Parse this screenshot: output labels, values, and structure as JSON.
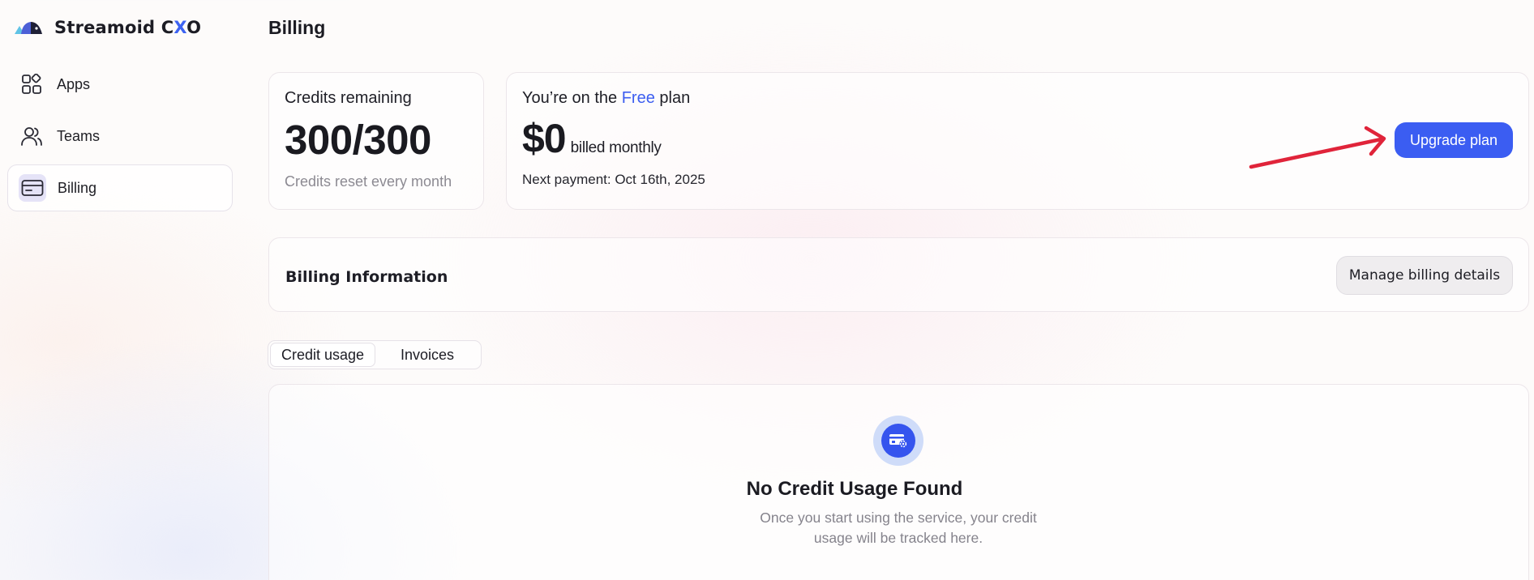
{
  "brand": {
    "name_prefix": "Streamoid C",
    "name_x": "X",
    "name_suffix": "O",
    "logo_icon": "streamoid-logo-icon"
  },
  "sidebar": {
    "items": [
      {
        "label": "Apps",
        "icon": "apps-grid-icon",
        "active": false
      },
      {
        "label": "Teams",
        "icon": "users-icon",
        "active": false
      },
      {
        "label": "Billing",
        "icon": "credit-card-icon",
        "active": true
      }
    ]
  },
  "page": {
    "title": "Billing"
  },
  "credits": {
    "label": "Credits remaining",
    "value": "300/300",
    "note": "Credits reset every month"
  },
  "plan": {
    "prefix": "You’re on the",
    "plan_name": "Free",
    "suffix": "plan",
    "price": "$0",
    "billing_period": "billed monthly",
    "next_payment": "Next payment: Oct 16th, 2025",
    "upgrade_label": "Upgrade plan"
  },
  "billing_info": {
    "title": "Billing Information",
    "manage_label": "Manage billing details"
  },
  "tabs": [
    {
      "label": "Credit usage",
      "active": true
    },
    {
      "label": "Invoices",
      "active": false
    }
  ],
  "empty_state": {
    "icon": "billing-settings-icon",
    "title": "No Credit Usage Found",
    "description": "Once you start using the service, your credit usage will be tracked here."
  },
  "colors": {
    "accent": "#3b5df2",
    "annotation_arrow": "#e0243a",
    "muted_text": "#8c8a92"
  }
}
